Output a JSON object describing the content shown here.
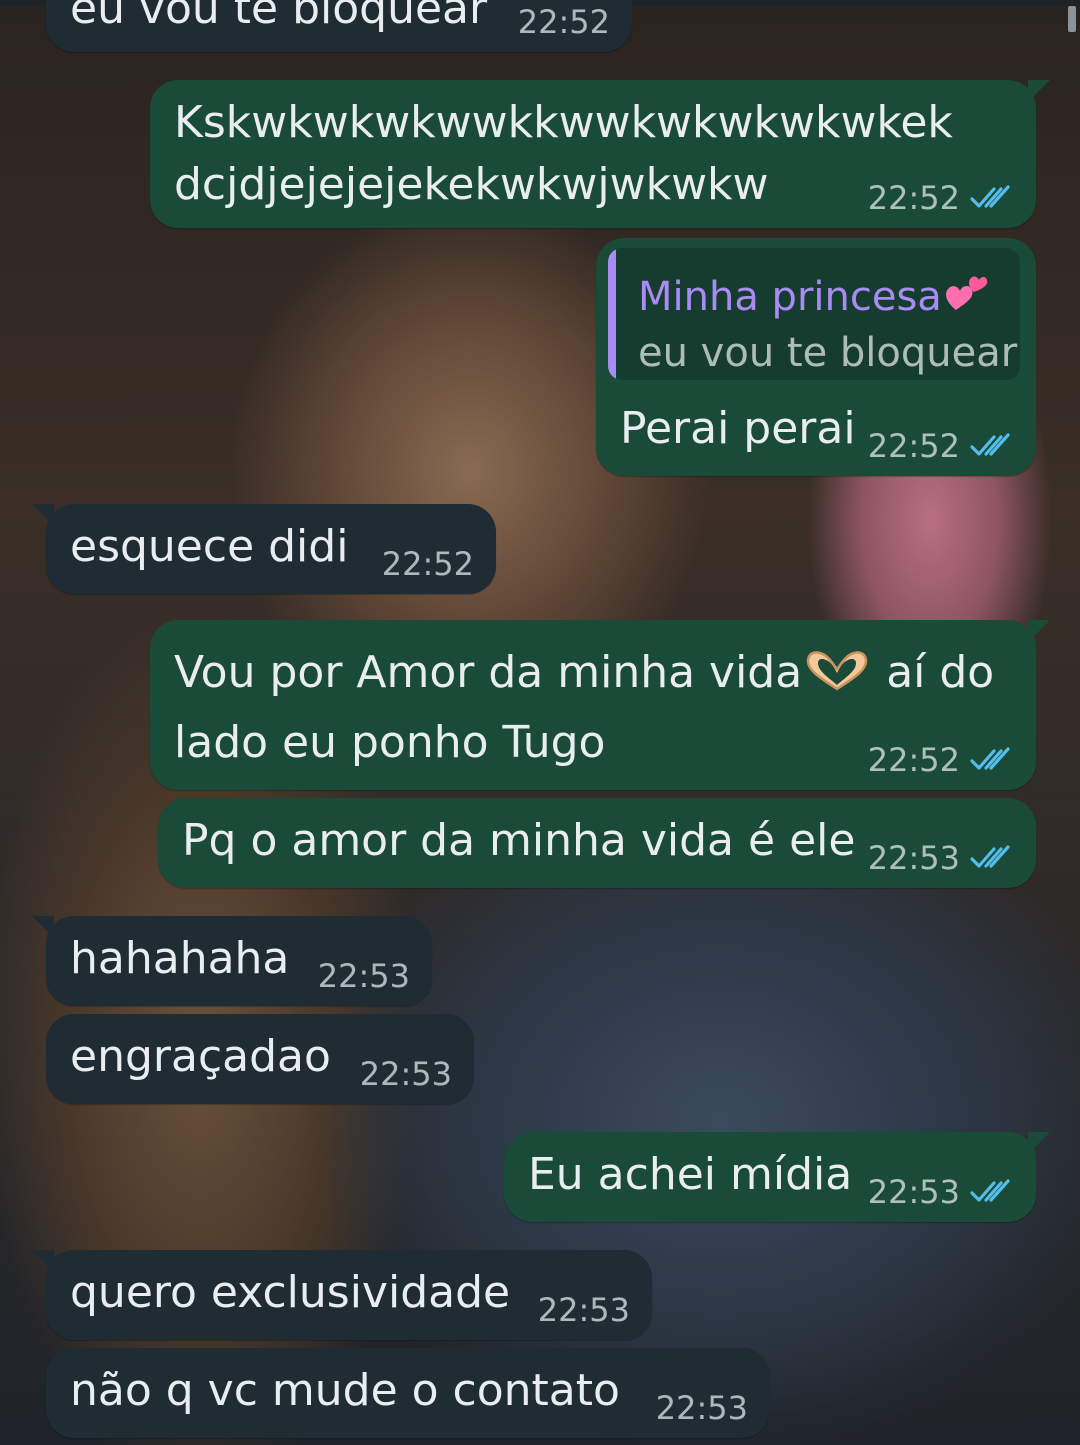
{
  "messages": [
    {
      "text": "eu vou te bloquear",
      "time": "22:52",
      "direction": "incoming"
    },
    {
      "text_lines": [
        "Kskwkwkwkwwkkwwkwkwkwkwkek",
        "dcjdjejejejekekwkwjwkwkw"
      ],
      "time": "22:52",
      "direction": "outgoing",
      "status": "read"
    },
    {
      "quote": {
        "author": "Minha princesa",
        "author_emoji": "two-hearts",
        "text": "eu vou te bloquear"
      },
      "text": "Perai perai",
      "time": "22:52",
      "direction": "outgoing",
      "status": "read"
    },
    {
      "text": "esquece didi",
      "time": "22:52",
      "direction": "incoming"
    },
    {
      "text_lines": [
        "Vou por Amor da minha vida",
        "aí do",
        "lado eu ponho Tugo"
      ],
      "emoji": "heart-hands",
      "time": "22:52",
      "direction": "outgoing",
      "status": "read"
    },
    {
      "text": "Pq o amor da minha vida é ele",
      "time": "22:53",
      "direction": "outgoing",
      "status": "read"
    },
    {
      "text": "hahahaha",
      "time": "22:53",
      "direction": "incoming"
    },
    {
      "text": "engraçadao",
      "time": "22:53",
      "direction": "incoming"
    },
    {
      "text": "Eu achei mídia",
      "time": "22:53",
      "direction": "outgoing",
      "status": "read"
    },
    {
      "text": "quero exclusividade",
      "time": "22:53",
      "direction": "incoming"
    },
    {
      "text": "não q vc mude o contato",
      "time": "22:53",
      "direction": "incoming"
    }
  ],
  "colors": {
    "incoming_bubble": "#1f2c34",
    "outgoing_bubble": "#1a4a38",
    "read_ticks": "#53bdeb",
    "quote_accent": "#a98bf5"
  }
}
